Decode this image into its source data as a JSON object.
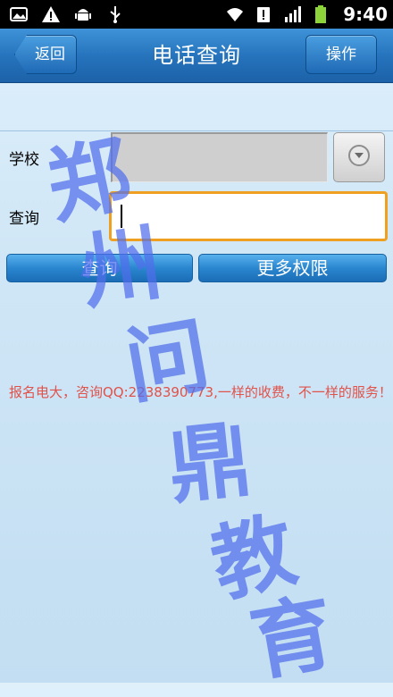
{
  "status_bar": {
    "time": "9:40",
    "icons_left": [
      "image-icon",
      "warning-icon",
      "android-icon",
      "usb-icon"
    ],
    "icons_right": [
      "wifi-icon",
      "alert-icon",
      "signal-icon",
      "battery-icon"
    ]
  },
  "title_bar": {
    "back_label": "返回",
    "title": "电话查询",
    "operation_label": "操作"
  },
  "form": {
    "school_label": "学校",
    "query_label": "查询",
    "query_value": ""
  },
  "buttons": {
    "query_label": "查询",
    "more_label": "更多权限"
  },
  "ad_text": "报名电大，咨询QQ:2238390773,一样的收费，不一样的服务！",
  "watermark": {
    "chars": [
      "郑",
      "州",
      "问",
      "鼎",
      "教",
      "育"
    ],
    "color": "#506eeb"
  },
  "colors": {
    "titlebar": "#2674bd",
    "input_focus": "#f0a020",
    "ad_text": "#e0524a"
  }
}
